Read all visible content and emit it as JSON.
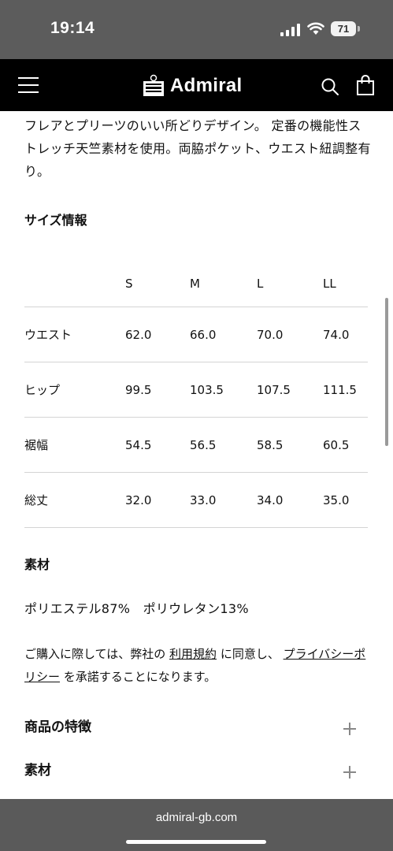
{
  "status_bar": {
    "time": "19:14",
    "battery": "71"
  },
  "header": {
    "brand": "Admiral"
  },
  "description": "フレアとプリーツのいい所どりデザイン。 定番の機能性ストレッチ天竺素材を使用。両脇ポケット、ウエスト紐調整有り。",
  "size_info": {
    "title": "サイズ情報",
    "columns": [
      "S",
      "M",
      "L",
      "LL"
    ],
    "rows": [
      {
        "label": "ウエスト",
        "values": [
          "62.0",
          "66.0",
          "70.0",
          "74.0"
        ]
      },
      {
        "label": "ヒップ",
        "values": [
          "99.5",
          "103.5",
          "107.5",
          "111.5"
        ]
      },
      {
        "label": "裾幅",
        "values": [
          "54.5",
          "56.5",
          "58.5",
          "60.5"
        ]
      },
      {
        "label": "総丈",
        "values": [
          "32.0",
          "33.0",
          "34.0",
          "35.0"
        ]
      }
    ]
  },
  "material": {
    "title": "素材",
    "text": "ポリエステル87%　ポリウレタン13%"
  },
  "notice": {
    "part1": "ご購入に際しては、弊社の ",
    "terms_link": "利用規約",
    "part2": " に同意し、 ",
    "privacy_link": "プライバシーポリシー",
    "part3": " を承諾することになります。"
  },
  "accordions": [
    {
      "label": "商品の特徴"
    },
    {
      "label": "素材"
    }
  ],
  "browser": {
    "url": "admiral-gb.com"
  }
}
